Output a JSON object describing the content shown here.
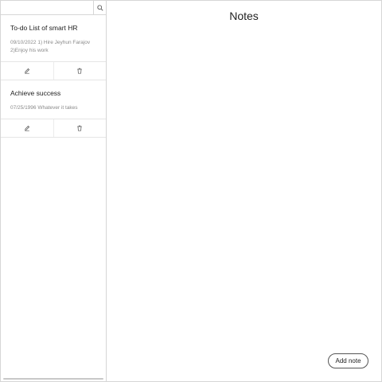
{
  "search": {
    "placeholder": "",
    "value": "",
    "icon": "search-icon"
  },
  "notes": [
    {
      "title": "To-do List of smart HR",
      "text": "09/10/2022 1) Hire Jeyhun Farajov 2)Enjoy his work",
      "edit_icon": "pencil-icon",
      "delete_icon": "trash-icon"
    },
    {
      "title": "Achieve success",
      "text": "07/25/1996 Whatever it takes",
      "edit_icon": "pencil-icon",
      "delete_icon": "trash-icon"
    }
  ],
  "main": {
    "title": "Notes",
    "add_button_label": "Add note"
  }
}
